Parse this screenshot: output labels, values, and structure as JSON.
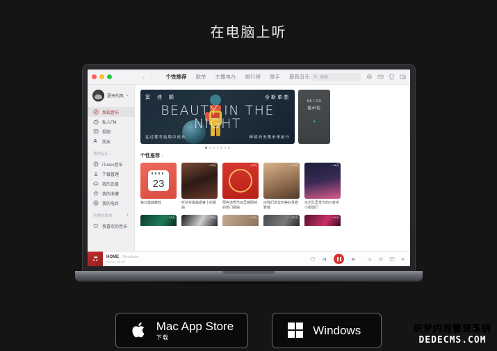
{
  "page": {
    "title": "在电脑上听",
    "background": "#151515"
  },
  "app": {
    "window_controls": [
      "close",
      "minimize",
      "maximize"
    ],
    "nav_back": "‹",
    "nav_forward": "›",
    "tabs": [
      {
        "label": "个性推荐",
        "active": true
      },
      {
        "label": "歌单",
        "active": false
      },
      {
        "label": "主播电台",
        "active": false
      },
      {
        "label": "排行榜",
        "active": false
      },
      {
        "label": "歌手",
        "active": false
      },
      {
        "label": "最新音乐",
        "active": false
      }
    ],
    "search": {
      "placeholder": "搜索",
      "value": ""
    },
    "toolbar_icons": [
      "gear-icon",
      "mail-icon",
      "skin-icon",
      "mini-window-icon"
    ]
  },
  "sidebar": {
    "user": {
      "name": "夏天的风",
      "caret": "▾"
    },
    "primary": [
      {
        "label": "发现音乐",
        "icon": "compass-icon",
        "selected": true
      },
      {
        "label": "私人FM",
        "icon": "radio-icon",
        "selected": false
      },
      {
        "label": "视频",
        "icon": "video-icon",
        "selected": false
      },
      {
        "label": "朋友",
        "icon": "friends-icon",
        "selected": false
      }
    ],
    "section_my_music": {
      "label": "我的音乐 ›"
    },
    "my_music": [
      {
        "label": "iTunes音乐",
        "icon": "itunes-icon"
      },
      {
        "label": "下载管理",
        "icon": "download-icon"
      },
      {
        "label": "我的云盘",
        "icon": "cloud-icon"
      },
      {
        "label": "我的收藏",
        "icon": "star-icon"
      },
      {
        "label": "我的电台",
        "icon": "antenna-icon"
      }
    ],
    "section_playlists": {
      "label": "创建的歌单",
      "add": "+"
    },
    "playlists": [
      {
        "label": "我喜欢的音乐",
        "icon": "heart-icon"
      }
    ]
  },
  "banner": {
    "artist": "窦 佳 嫄",
    "tagline": "全新单曲",
    "headline": "BEAUTY IN THE NIGHT",
    "foot_left": "在过程写结局中成长",
    "foot_right": "继续向无限未来前行",
    "pager": {
      "count": 7,
      "active": 0
    }
  },
  "banner_side": {
    "date": "06 / 03",
    "city": "福州站",
    "mark": "✦"
  },
  "recommend": {
    "heading": "个性推荐",
    "chevron": "›",
    "cards": [
      {
        "label": "每日歌曲推荐",
        "badge": "",
        "thumb": "calendar",
        "day": "23"
      },
      {
        "label": "听前任歌曲婚宴上的歌曲",
        "badge": "♪ 26万",
        "thumb": "photo"
      },
      {
        "label": "那些选秀节目里被刷掉的热门歌曲",
        "badge": "♪ 86万",
        "thumb": "poster"
      },
      {
        "label": "向我们逝去的美好青春致敬",
        "badge": "♪ 31万",
        "thumb": "beach"
      },
      {
        "label": "在乐队里发光的只有手小姐姐们",
        "badge": "♪ 48万",
        "thumb": "concert"
      }
    ],
    "cards_row2": [
      {
        "badge": "♪ 19万"
      },
      {
        "badge": "♪ 33万"
      },
      {
        "badge": "♪ 12万"
      },
      {
        "badge": "♪ 57万"
      },
      {
        "badge": "♪ 44万"
      }
    ]
  },
  "player": {
    "cover_glyph": "♬",
    "song": "HOME",
    "artist": "- Novoksun",
    "time": "00:41 / 03:28",
    "like_icon": "heart-icon",
    "prev_icon": "previous-icon",
    "play_state": "pause",
    "next_icon": "next-icon",
    "right_icons": [
      "loop-icon",
      "playlist-icon",
      "lyrics-icon",
      "volume-icon"
    ]
  },
  "downloads": [
    {
      "platform": "mac",
      "icon": "apple-logo",
      "label": "Mac App Store",
      "sub": "下载"
    },
    {
      "platform": "windows",
      "icon": "windows-logo",
      "label": "Windows",
      "sub": ""
    }
  ],
  "watermark": {
    "line1": "织梦内容管理系统",
    "line2": "DEDECMS.COM"
  }
}
